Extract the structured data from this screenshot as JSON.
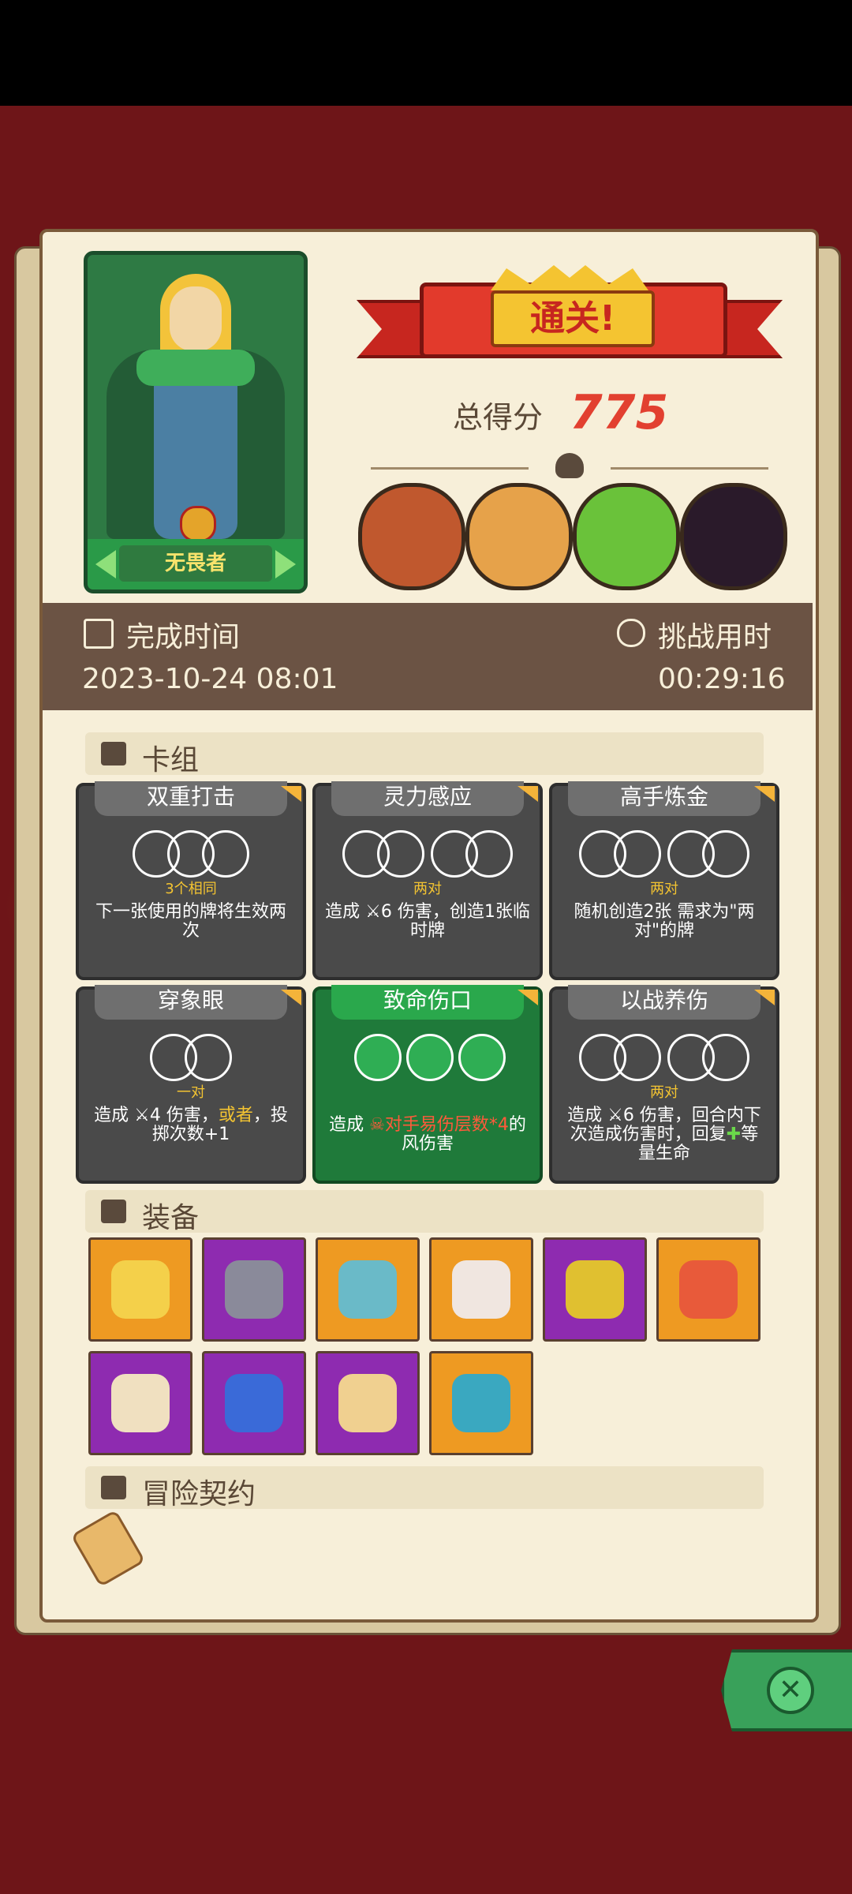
{
  "result": {
    "title": "通关!",
    "score_label": "总得分",
    "score": "775"
  },
  "hero": {
    "name": "无畏者"
  },
  "info": {
    "finish_label": "完成时间",
    "finish_value": "2023-10-24 08:01",
    "time_label": "挑战用时",
    "time_value": "00:29:16"
  },
  "sections": {
    "deck": "卡组",
    "equipment": "装备",
    "contract": "冒险契约"
  },
  "cards": [
    {
      "title": "双重打击",
      "sub": "3个相同",
      "desc_parts": [
        "下一张使用的牌将生效两次"
      ]
    },
    {
      "title": "灵力感应",
      "sub": "两对",
      "desc_parts": [
        "造成",
        "6 伤害，创造1张临时牌"
      ]
    },
    {
      "title": "高手炼金",
      "sub": "两对",
      "desc_parts": [
        "随机创造2张 需求为\"两对\"的牌"
      ]
    },
    {
      "title": "穿象眼",
      "sub": "一对",
      "desc_parts": [
        "造成",
        "4 伤害，",
        "或者",
        "，投掷次数+1"
      ]
    },
    {
      "title": "致命伤口",
      "sub": "",
      "desc_parts": [
        "造成",
        "对手易伤层数*4",
        "的风伤害"
      ]
    },
    {
      "title": "以战养伤",
      "sub": "两对",
      "desc_parts": [
        "造成",
        "6 伤害，回合内下次造成伤害时，回复",
        "等量生命"
      ]
    }
  ],
  "colors": {
    "orange_item": "#ee9a22",
    "purple_item": "#8e2bb0",
    "accent_red": "#e24030",
    "panel": "#f7efd9"
  }
}
